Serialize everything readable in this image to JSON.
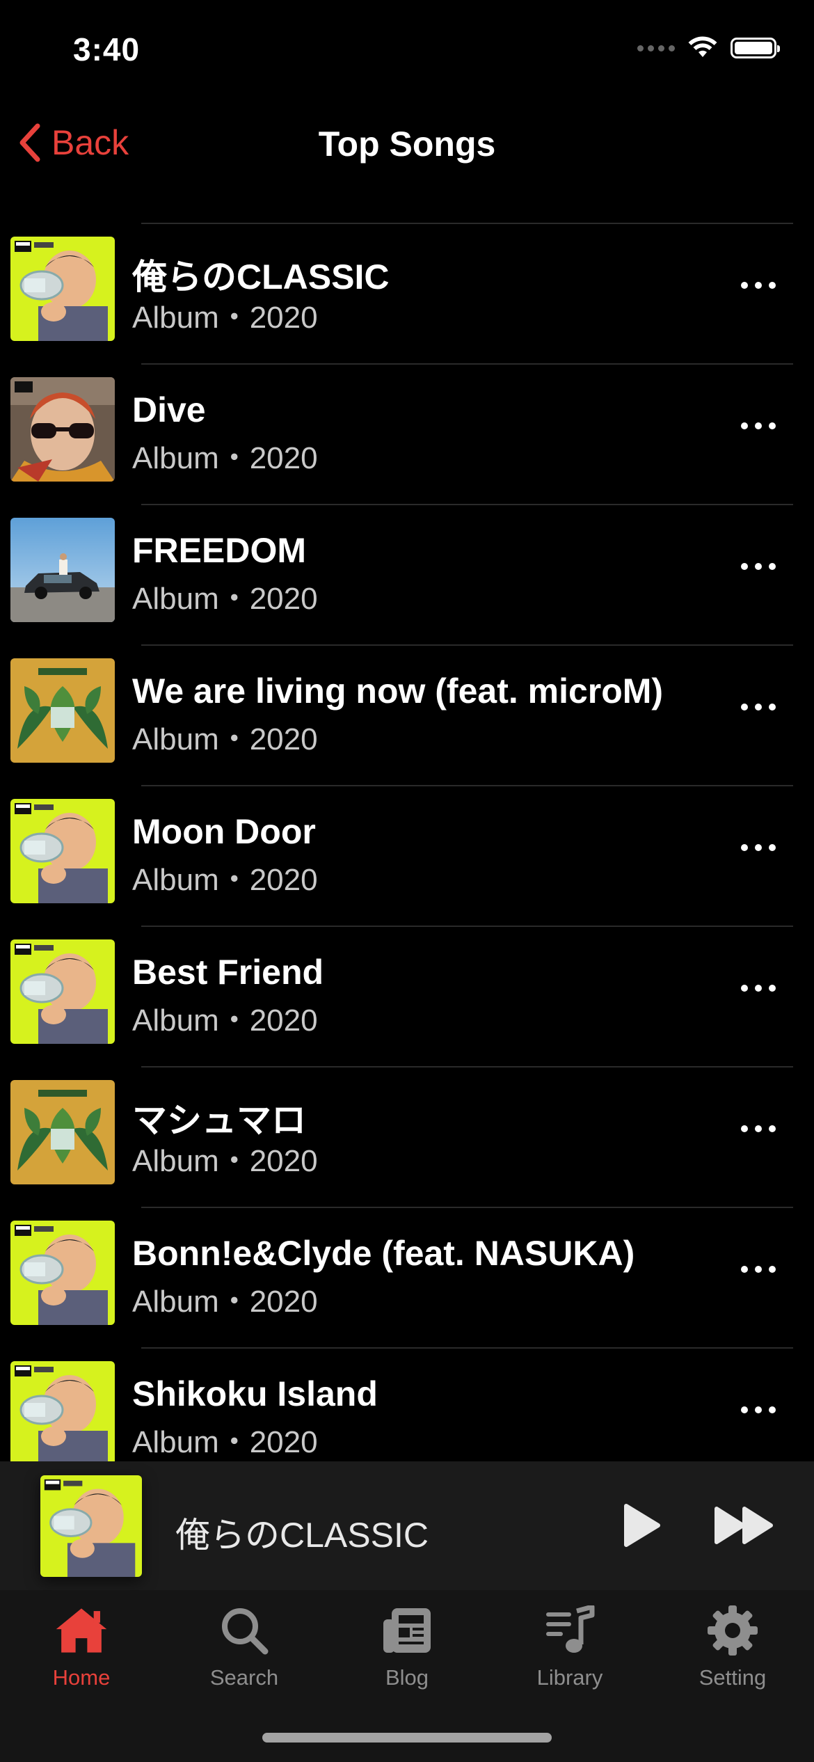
{
  "status_bar": {
    "time": "3:40"
  },
  "nav": {
    "back_label": "Back",
    "title": "Top Songs"
  },
  "songs": [
    {
      "title": "俺らのCLASSIC",
      "subtitle": "Album・2020",
      "art": "lime-boy"
    },
    {
      "title": "Dive",
      "subtitle": "Album・2020",
      "art": "grandma"
    },
    {
      "title": "FREEDOM",
      "subtitle": "Album・2020",
      "art": "car"
    },
    {
      "title": "We are living now (feat. microM)",
      "subtitle": "Album・2020",
      "art": "jungle"
    },
    {
      "title": "Moon Door",
      "subtitle": "Album・2020",
      "art": "lime-boy"
    },
    {
      "title": "Best Friend",
      "subtitle": "Album・2020",
      "art": "lime-boy"
    },
    {
      "title": "マシュマロ",
      "subtitle": "Album・2020",
      "art": "jungle"
    },
    {
      "title": "Bonn!e&Clyde (feat. NASUKA)",
      "subtitle": "Album・2020",
      "art": "lime-boy"
    },
    {
      "title": "Shikoku Island",
      "subtitle": "Album・2020",
      "art": "lime-boy"
    }
  ],
  "mini_player": {
    "title": "俺らのCLASSIC"
  },
  "tabs": [
    {
      "label": "Home",
      "icon": "home-icon",
      "active": true
    },
    {
      "label": "Search",
      "icon": "search-icon",
      "active": false
    },
    {
      "label": "Blog",
      "icon": "newspaper-icon",
      "active": false
    },
    {
      "label": "Library",
      "icon": "music-library-icon",
      "active": false
    },
    {
      "label": "Setting",
      "icon": "gear-icon",
      "active": false
    }
  ],
  "colors": {
    "accent": "#e8413b",
    "background": "#000000",
    "mini_player_bg": "#1b1b1b",
    "tab_bar_bg": "#151515",
    "inactive_tab": "#8e8e8e"
  }
}
